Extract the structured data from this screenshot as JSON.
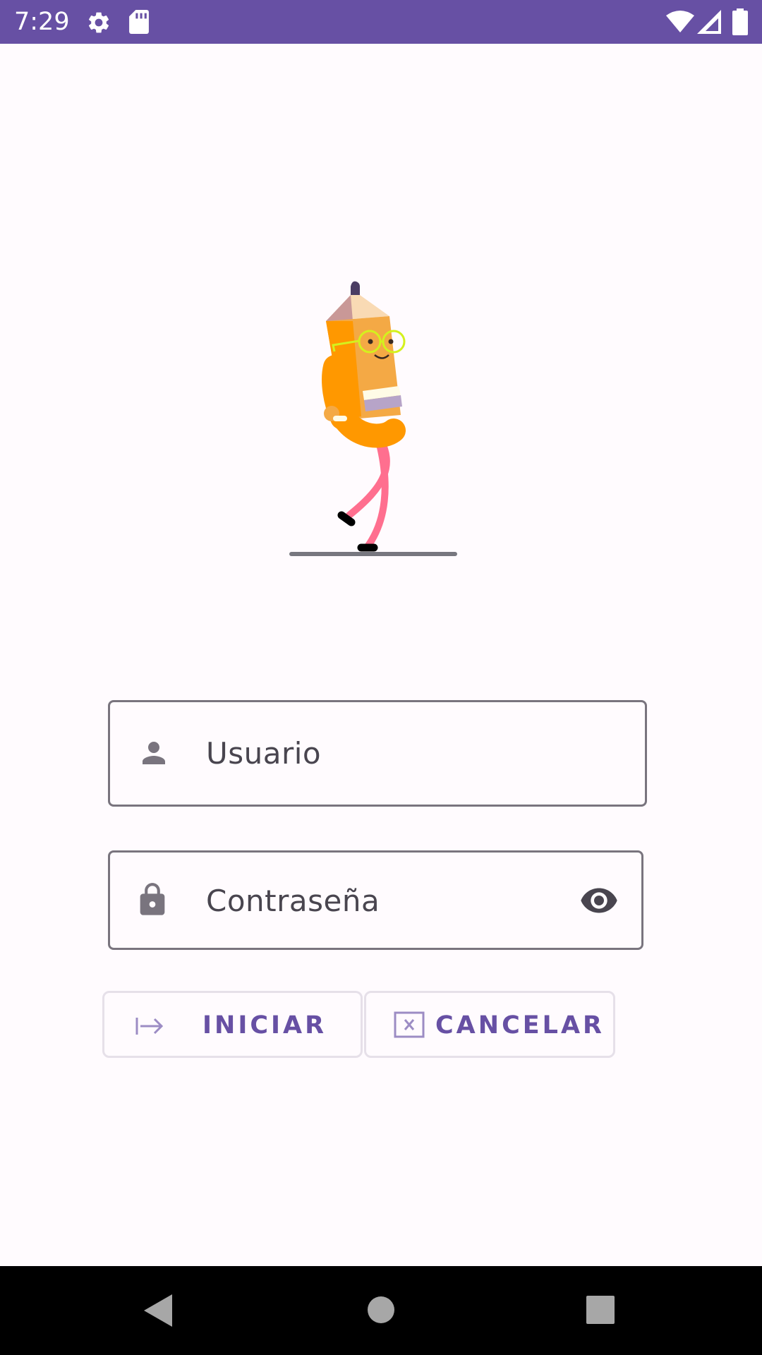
{
  "status_bar": {
    "time": "7:29",
    "icons": [
      "settings-icon",
      "sd-card-icon",
      "wifi-icon",
      "signal-icon",
      "battery-icon"
    ],
    "background": "#6750a4"
  },
  "illustration": {
    "name": "walking-pencil-mascot"
  },
  "form": {
    "username_placeholder": "Usuario",
    "password_placeholder": "Contraseña",
    "username_icon": "person-icon",
    "password_icon": "lock-icon",
    "password_toggle_icon": "eye-icon"
  },
  "buttons": {
    "login_label": "INICIAR",
    "login_icon": "login-arrow-icon",
    "cancel_label": "CANCELAR",
    "cancel_icon": "close-box-icon"
  },
  "navigation": {
    "icons": [
      "back-icon",
      "home-icon",
      "recents-icon"
    ]
  },
  "colors": {
    "primary": "#6750a4",
    "background": "#fffbfe",
    "outline": "#79747e"
  }
}
